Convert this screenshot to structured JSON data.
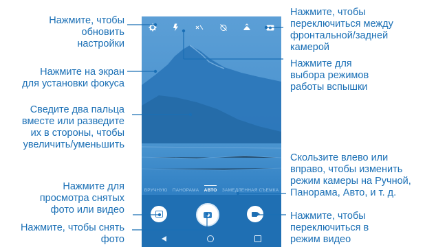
{
  "callouts": {
    "settings": "Нажмите, чтобы\nобновить\nнастройки",
    "focus": "Нажмите на экран\nдля установки фокуса",
    "zoom": "Сведите два пальца\nвместе или разведите\nих в стороны, чтобы\nувеличить/уменьшить",
    "gallery": "Нажмите для\nпросмотра снятых\nфото или видео",
    "shutter": "Нажмите, чтобы снять\nфото",
    "switch_camera": "Нажмите, чтобы\nпереключиться между\nфронтальной/задней\nкамерой",
    "flash": "Нажмите для\nвыбора режимов\nработы вспышки",
    "modes": "Скользите влево или\nвправо, чтобы изменить\nрежим камеры на Ручной,\nПанорама, Авто, и т. д.",
    "video": "Нажмите, чтобы\nпереключиться в\nрежим видео"
  },
  "camera": {
    "modes": [
      "ВРУЧНУЮ",
      "ПАНОРАМА",
      "АВТО",
      "ЗАМЕДЛЕННАЯ СЪЕМКА"
    ],
    "active_mode": "АВТО",
    "top_icons": [
      "settings-gear-icon",
      "flash-icon",
      "hdr-off-icon",
      "timer-off-icon",
      "scene-icon",
      "switch-camera-icon"
    ]
  },
  "colors": {
    "accent": "#1a6fb5",
    "phone_bg": "#2f7fc3",
    "bottom_bar": "#1f6fb3"
  }
}
